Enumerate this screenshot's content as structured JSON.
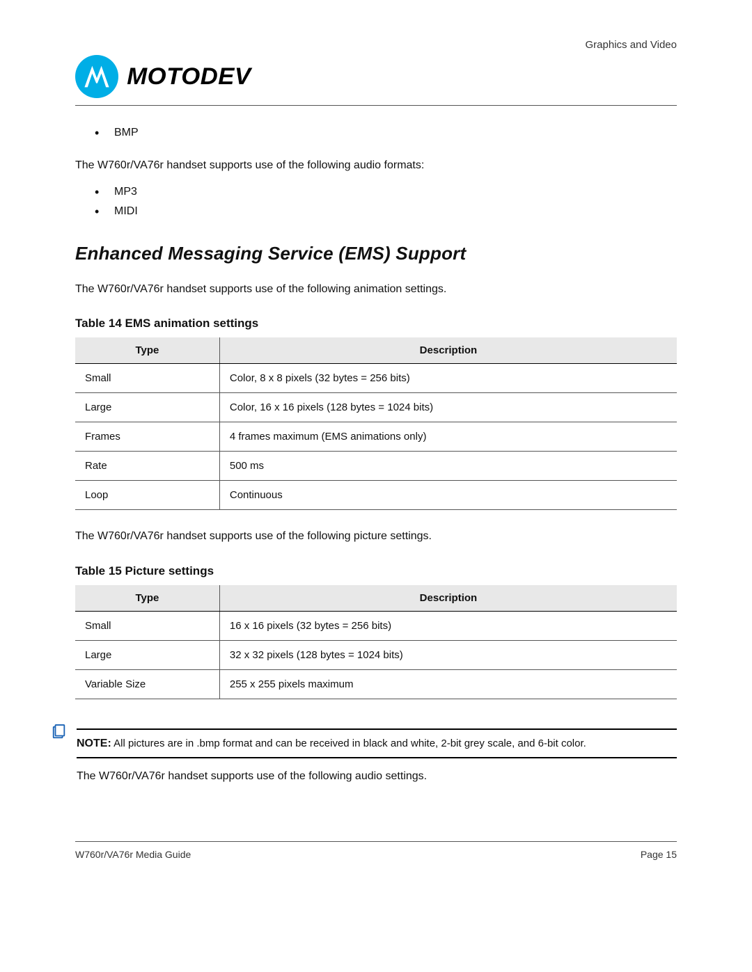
{
  "header": {
    "running_head": "Graphics and Video",
    "brand_word": "MOTODEV",
    "logo_name": "motorola-logo"
  },
  "content": {
    "bullets_top": [
      "BMP"
    ],
    "p_audio_formats_intro": "The W760r/VA76r handset supports use of the following audio formats:",
    "bullets_audio": [
      "MP3",
      "MIDI"
    ],
    "section_title": "Enhanced Messaging Service (EMS) Support",
    "p_anim_intro": "The W760r/VA76r handset supports use of the following animation settings.",
    "table14_caption": "Table 14 EMS animation settings",
    "table14": {
      "cols": [
        "Type",
        "Description"
      ],
      "rows": [
        {
          "type": "Small",
          "desc": "Color, 8 x 8 pixels (32 bytes = 256 bits)"
        },
        {
          "type": "Large",
          "desc": "Color, 16 x 16 pixels (128 bytes = 1024 bits)"
        },
        {
          "type": "Frames",
          "desc": "4 frames maximum (EMS animations only)"
        },
        {
          "type": "Rate",
          "desc": "500 ms"
        },
        {
          "type": "Loop",
          "desc": "Continuous"
        }
      ]
    },
    "p_picture_intro": "The W760r/VA76r handset supports use of the following picture settings.",
    "table15_caption": "Table 15 Picture settings",
    "table15": {
      "cols": [
        "Type",
        "Description"
      ],
      "rows": [
        {
          "type": "Small",
          "desc": "16 x 16 pixels (32 bytes = 256 bits)"
        },
        {
          "type": "Large",
          "desc": "32 x 32 pixels (128 bytes = 1024 bits)"
        },
        {
          "type": "Variable Size",
          "desc": "255 x 255 pixels maximum"
        }
      ]
    },
    "note_label": "NOTE:",
    "note_text": "All pictures are in .bmp format and can be received in black and white, 2-bit grey scale, and 6-bit color.",
    "p_audio_settings_intro": "The W760r/VA76r handset supports use of the following audio settings."
  },
  "footer": {
    "left": "W760r/VA76r Media Guide",
    "right": "Page 15"
  }
}
